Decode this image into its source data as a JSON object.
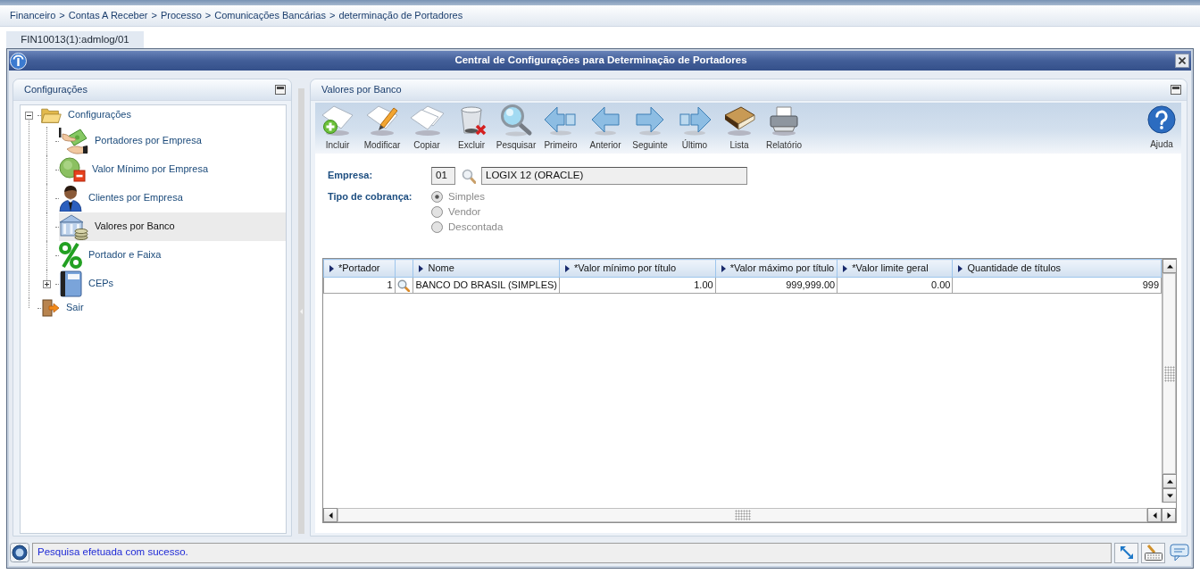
{
  "breadcrumb": {
    "items": [
      "Financeiro",
      "Contas A Receber",
      "Processo",
      "Comunicações Bancárias",
      "determinação de Portadores"
    ],
    "separator": ">"
  },
  "tabs": [
    {
      "label": "FIN10013(1):admlog/01",
      "selected": true
    }
  ],
  "window": {
    "title": "Central de Configurações para Determinação de Portadores"
  },
  "sidebar": {
    "title": "Configurações",
    "tree": [
      {
        "label": "Configurações",
        "expanded": true,
        "selected": false,
        "children": [
          {
            "label": "Portadores por Empresa",
            "selected": false
          },
          {
            "label": "Valor Mínimo por Empresa",
            "selected": false
          },
          {
            "label": "Clientes por Empresa",
            "selected": false
          },
          {
            "label": "Valores por Banco",
            "selected": true
          },
          {
            "label": "Portador e Faixa",
            "selected": false
          },
          {
            "label": "CEPs",
            "expanded": false,
            "selected": false
          }
        ]
      },
      {
        "label": "Sair",
        "selected": false
      }
    ]
  },
  "content": {
    "title": "Valores por Banco",
    "toolbar": [
      {
        "label": "Incluir"
      },
      {
        "label": "Modificar"
      },
      {
        "label": "Copiar"
      },
      {
        "label": "Excluir"
      },
      {
        "label": "Pesquisar"
      },
      {
        "label": "Primeiro"
      },
      {
        "label": "Anterior"
      },
      {
        "label": "Seguinte"
      },
      {
        "label": "Último"
      },
      {
        "label": "Lista"
      },
      {
        "label": "Relatório"
      }
    ],
    "help_button": {
      "label": "Ajuda"
    },
    "form": {
      "empresa": {
        "label": "Empresa:",
        "code": "01",
        "description": "LOGIX 12 (ORACLE)"
      },
      "tipo_cobranca": {
        "label": "Tipo de cobrança:",
        "options": [
          {
            "label": "Simples",
            "selected": true,
            "disabled": true
          },
          {
            "label": "Vendor",
            "selected": false,
            "disabled": true
          },
          {
            "label": "Descontada",
            "selected": false,
            "disabled": true
          }
        ]
      }
    },
    "table": {
      "columns": [
        {
          "kind": "number",
          "label": "*Portador"
        },
        {
          "kind": "lookup"
        },
        {
          "kind": "text",
          "label": "Nome"
        },
        {
          "kind": "number",
          "label": "*Valor mínimo por título"
        },
        {
          "kind": "number",
          "label": "*Valor máximo por título"
        },
        {
          "kind": "number",
          "label": "*Valor limite geral"
        },
        {
          "kind": "number",
          "label": "Quantidade de títulos"
        }
      ],
      "rows": [
        {
          "cells": [
            "1",
            "",
            "BANCO DO BRASIL (SIMPLES)",
            "1.00",
            "999,999.00",
            "0.00",
            "999"
          ]
        }
      ]
    }
  },
  "status_bar": {
    "message": "Pesquisa efetuada com sucesso."
  }
}
